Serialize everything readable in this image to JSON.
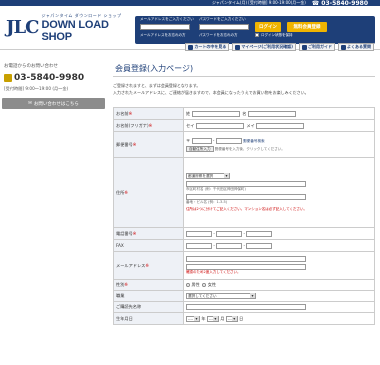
{
  "topbar": {
    "hours": "ジャパンタイム(月) [受付時間] 9:00-19:00(月〜金)",
    "phone": "03-5840-9980"
  },
  "logo": {
    "mark": "JLC",
    "sub": "ジャパンタイム  ダウンロード  ショップ",
    "main": "DOWN LOAD SHOP"
  },
  "login": {
    "email_label": "メールアドレスをご入力ください",
    "password_label": "パスワードをご入力ください",
    "login_button": "ログイン",
    "register_button": "無料会員登録",
    "forgot_email": "メールアドレスをお忘れの方",
    "forgot_password": "パスワードをお忘れの方",
    "remember": "ログイン状態を保持"
  },
  "nav": {
    "cart": "カートの中を見る",
    "mypage": "マイページ(ご利用状況確認)",
    "guide": "ご利用ガイド",
    "faq": "よくある質問"
  },
  "sidebar": {
    "title": "お電話からのお問い合わせ",
    "phone": "03-5840-9980",
    "hours": "[受付時間] 9:00〜19:00 (月〜金)",
    "contact_button": "お問い合わせはこちら"
  },
  "main": {
    "title": "会員登録(入力ページ)",
    "intro1": "ご登録されますと、まずは会員登録となります。",
    "intro2": "入力されたメールアドレスに、ご連絡が届きますので、本会員になったうえでお買い物をお楽しみください。"
  },
  "form": {
    "name": {
      "label": "お名前",
      "sei": "姓",
      "mei": "名"
    },
    "kana": {
      "label": "お名前(フリガナ)",
      "sei": "セイ",
      "mei": "メイ"
    },
    "zip": {
      "label": "郵便番号",
      "mark": "〒",
      "dash": "-",
      "link": "郵便番号検索",
      "auto_button": "自動住所入力",
      "note": "郵便番号を入力後、クリックしてください。"
    },
    "address": {
      "label": "住所",
      "pref_select": "都道府県を選択",
      "note1": "市区町村名 (例：千代田区神田神保町)",
      "note2": "番地・ビル名 (例：1-3-5)",
      "note_red": "住所は2つに分けてご記入ください。マンション名は必ず記入してください。"
    },
    "tel": {
      "label": "電話番号",
      "dash": "-"
    },
    "fax": {
      "label": "FAX",
      "dash": "-"
    },
    "email": {
      "label": "メールアドレス",
      "note_red": "確認のため2度入力してください。"
    },
    "gender": {
      "label": "性別",
      "male": "男性",
      "female": "女性"
    },
    "job": {
      "label": "職業",
      "select": "選択してください"
    },
    "purchase": {
      "label": "ご購読先名称"
    },
    "birthday": {
      "label": "生年月日",
      "year": "年",
      "month": "月",
      "day": "日",
      "empty": "----"
    },
    "required_mark": "※"
  }
}
